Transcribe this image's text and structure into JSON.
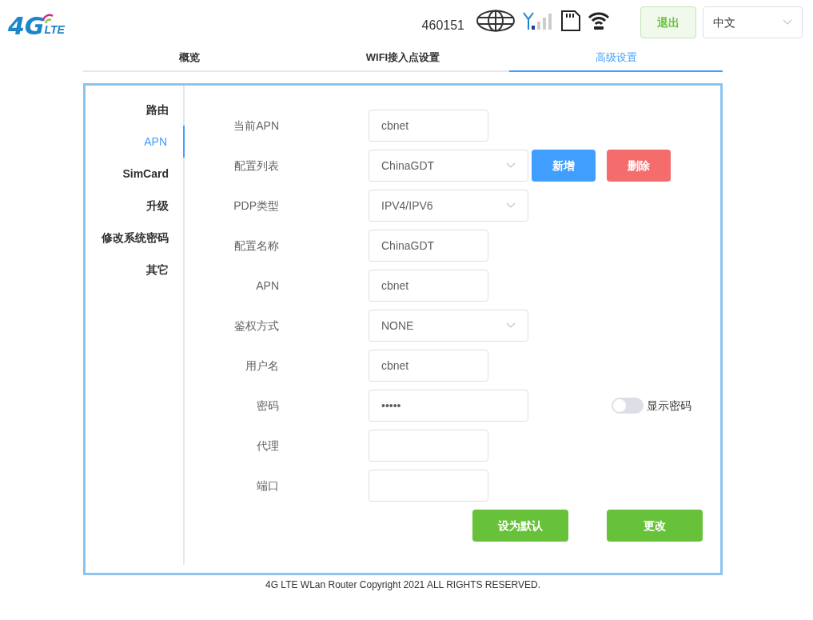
{
  "logo": {
    "main": "4G",
    "sub": "LTE"
  },
  "header": {
    "operator": "460151",
    "logout": "退出",
    "language": "中文"
  },
  "tabs": [
    {
      "label": "概览",
      "selected": false
    },
    {
      "label": "WIFI接入点设置",
      "selected": false
    },
    {
      "label": "高级设置",
      "selected": true
    }
  ],
  "sidebar": {
    "items": [
      {
        "label": "路由",
        "selected": false
      },
      {
        "label": "APN",
        "selected": true
      },
      {
        "label": "SimCard",
        "selected": false
      },
      {
        "label": "升级",
        "selected": false
      },
      {
        "label": "修改系统密码",
        "selected": false
      },
      {
        "label": "其它",
        "selected": false
      }
    ]
  },
  "form": {
    "fields": [
      {
        "kind": "text",
        "label": "当前APN",
        "value": "cbnet"
      },
      {
        "kind": "select",
        "label": "配置列表",
        "value": "ChinaGDT",
        "buttons": [
          {
            "label": "新增",
            "kind": "primary"
          },
          {
            "label": "删除",
            "kind": "danger"
          }
        ]
      },
      {
        "kind": "select",
        "label": "PDP类型",
        "value": "IPV4/IPV6"
      },
      {
        "kind": "text",
        "label": "配置名称",
        "value": "ChinaGDT"
      },
      {
        "kind": "text",
        "label": "APN",
        "value": "cbnet"
      },
      {
        "kind": "select",
        "label": "鉴权方式",
        "value": "NONE"
      },
      {
        "kind": "text",
        "label": "用户名",
        "value": "cbnet"
      },
      {
        "kind": "password",
        "label": "密码",
        "value": "•••••",
        "toggle": {
          "label": "显示密码",
          "on": false
        }
      },
      {
        "kind": "text",
        "label": "代理"
      },
      {
        "kind": "text",
        "label": "端口"
      }
    ],
    "actions": [
      "设为默认",
      "更改"
    ]
  },
  "footer": "4G LTE WLan Router Copyright 2021 ALL RIGHTS RESERVED."
}
